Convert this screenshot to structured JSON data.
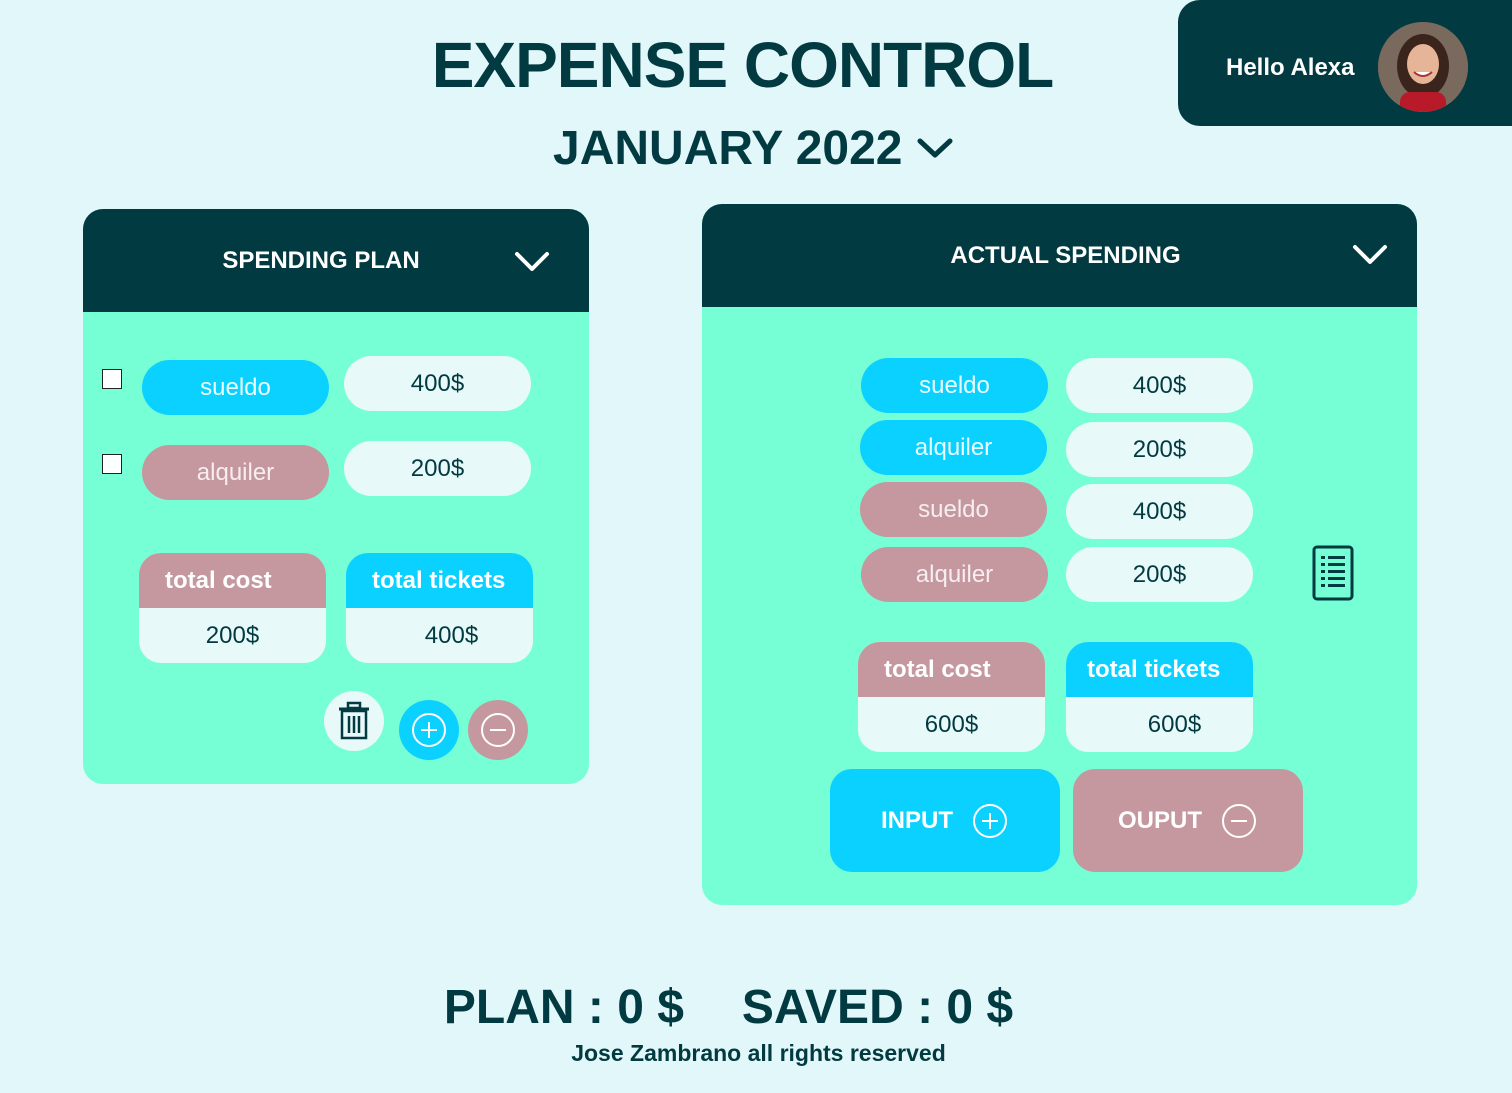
{
  "header": {
    "title": "EXPENSE CONTROL",
    "month": "JANUARY 2022",
    "greeting": "Hello Alexa"
  },
  "spending_plan": {
    "title": "SPENDING PLAN",
    "rows": [
      {
        "label": "sueldo",
        "amount": "400$",
        "kind": "income"
      },
      {
        "label": "alquiler",
        "amount": "200$",
        "kind": "expense"
      }
    ],
    "total_cost_label": "total cost",
    "total_cost_value": "200$",
    "total_tickets_label": "total tickets",
    "total_tickets_value": "400$"
  },
  "actual_spending": {
    "title": "ACTUAL SPENDING",
    "rows": [
      {
        "label": "sueldo",
        "amount": "400$",
        "kind": "income"
      },
      {
        "label": "alquiler",
        "amount": "200$",
        "kind": "income"
      },
      {
        "label": "sueldo",
        "amount": "400$",
        "kind": "expense"
      },
      {
        "label": "alquiler",
        "amount": "200$",
        "kind": "expense"
      }
    ],
    "total_cost_label": "total cost",
    "total_cost_value": "600$",
    "total_tickets_label": "total tickets",
    "total_tickets_value": "600$",
    "input_label": "INPUT",
    "output_label": "OUPUT"
  },
  "footer": {
    "plan": "PLAN : 0 $",
    "saved": "SAVED : 0 $",
    "copyright": "Jose Zambrano all rights reserved"
  },
  "colors": {
    "background": "#e1f7f9",
    "dark": "#023a41",
    "panel": "#76ffd5",
    "income": "#0ad1ff",
    "expense": "#c4989e",
    "light": "#e8f9fa"
  }
}
